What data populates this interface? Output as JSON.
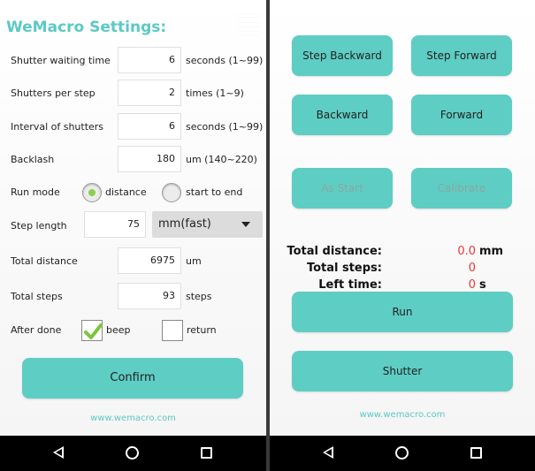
{
  "settings": {
    "title": "WeMacro Settings:",
    "rows": {
      "shutter_wait": {
        "label": "Shutter waiting time",
        "value": "6",
        "unit": "seconds (1~99)"
      },
      "shutters_per_step": {
        "label": "Shutters per step",
        "value": "2",
        "unit": "times (1~9)"
      },
      "interval": {
        "label": "Interval of shutters",
        "value": "6",
        "unit": "seconds (1~99)"
      },
      "backlash": {
        "label": "Backlash",
        "value": "180",
        "unit": "um (140~220)"
      },
      "run_mode": {
        "label": "Run mode",
        "option_distance": "distance",
        "option_start_to_end": "start to end",
        "selected": "distance"
      },
      "step_length": {
        "label": "Step length",
        "value": "75",
        "dropdown_value": "mm(fast)"
      },
      "total_distance": {
        "label": "Total distance",
        "value": "6975",
        "unit": "um"
      },
      "total_steps": {
        "label": "Total steps",
        "value": "93",
        "unit": "steps"
      },
      "after_done": {
        "label": "After done",
        "beep_label": "beep",
        "beep_checked": true,
        "return_label": "return",
        "return_checked": false
      }
    },
    "confirm_label": "Confirm",
    "website": "www.wemacro.com",
    "accent_color": "#5ecdc4",
    "menu_icon": "hamburger-menu-icon"
  },
  "control": {
    "buttons": {
      "step_backward": "Step Backward",
      "step_forward": "Step Forward",
      "backward": "Backward",
      "forward": "Forward",
      "as_start": "As Start",
      "calibrate": "Calibrate"
    },
    "stats": {
      "total_distance_label": "Total distance:",
      "total_distance_value": "0.0",
      "total_distance_unit": "mm",
      "total_steps_label": "Total steps:",
      "total_steps_value": "0",
      "left_time_label": "Left time:",
      "left_time_value": "0",
      "left_time_unit": "s"
    },
    "run_label": "Run",
    "shutter_label": "Shutter",
    "website": "www.wemacro.com",
    "value_color": "#e53935"
  },
  "navbar": {
    "icons": [
      "back-icon",
      "home-icon",
      "recent-apps-icon"
    ]
  }
}
